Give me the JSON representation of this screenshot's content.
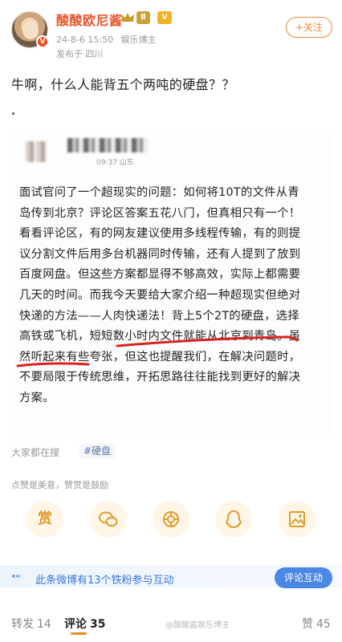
{
  "header": {
    "user_name": "酸酸欧尼酱",
    "level_badge": "Ⅱ",
    "vip_label": "V",
    "verified_mark": "V",
    "date_time": "24-8-6 15:50",
    "user_tag": "娱乐博主",
    "location": "发布于 四川",
    "follow_label": "+关注"
  },
  "post": {
    "main_text": "牛啊，什么人能背五个两吨的硬盘？？",
    "embed_time": "09:37 山东",
    "embed_lines": [
      "面试官问了一个超现实的问题：如何将10T的文件从青",
      "岛传到北京？评论区答案五花八门，但真相只有一个！",
      "看看评论区，有的网友建议使用多线程传输，有的则提",
      "议分割文件后用多台机器同时传输，还有人提到了放到",
      "百度网盘。但这些方案都显得不够高效，实际上都需要",
      "几天的时间。而我今天要给大家介绍一种超现实但绝对",
      "快递的方法——人肉快递法！背上5个2T的硬盘，选择",
      "高铁或飞机，短短数小时内文件就能从北京到青岛。虽",
      "然听起来有些夸张，但这也提醒我们，在解决问题时，",
      "不要局限于传统思维，开拓思路往往能找到更好的解决",
      "方案。"
    ]
  },
  "tags": {
    "search_label": "大家都在搜",
    "hashtag": "#硬盘",
    "like_hint": "点赞是美意，赞赏是鼓励"
  },
  "reward_icons": [
    {
      "name": "reward-icon",
      "glyph": "赏"
    },
    {
      "name": "wechat-icon",
      "glyph": ""
    },
    {
      "name": "moments-icon",
      "glyph": ""
    },
    {
      "name": "qq-icon",
      "glyph": ""
    },
    {
      "name": "image-share-icon",
      "glyph": ""
    }
  ],
  "fan_banner": {
    "text": "此条微博有13个铁粉参与互动",
    "button_label": "评论互动"
  },
  "tabs": {
    "repost_label": "转发",
    "repost_count": "14",
    "comment_label": "评论",
    "comment_count": "35",
    "like_label": "赞",
    "like_count": "45",
    "watermark": "@酸酸酱娱乐博主"
  },
  "colors": {
    "accent_orange": "#f08a3c",
    "link_blue": "#3a78d6",
    "underline_red": "#d8241c"
  }
}
